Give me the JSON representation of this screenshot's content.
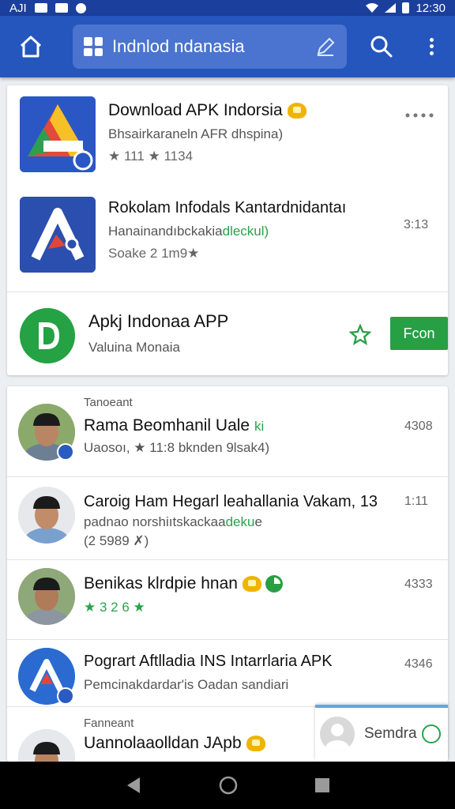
{
  "status": {
    "left_text": "AJI",
    "time": "12:30"
  },
  "appbar": {
    "search_text": "Indnlod ndanasia"
  },
  "apps": [
    {
      "title": "Download APK Indorsia",
      "subtitle": "Bhsairkaraneln AFR dhspina)",
      "rating": "★ 111 ★ 1134"
    },
    {
      "title": "Rokolam Infodals Kantardnidantaı",
      "subtitle_a": "Hanainandıbckakia",
      "subtitle_b": "dleckul)",
      "meta": "Soake 2 1m9★",
      "time": "3:13"
    },
    {
      "title": "Apkj Indonaa APP",
      "subtitle": "Valuina Monaia",
      "button": "Fcon"
    }
  ],
  "feed_label_1": "Tanoeant",
  "feed": [
    {
      "title": "Rama Beomhanil Uale",
      "title_tag": "ki",
      "meta": "Uaosoı, ★ 11:8 bknden 9lsak4)",
      "time": "4308"
    },
    {
      "title": "Caroig Ham Hegarl leahallania Vakam, 13",
      "line2_a": "padnao norshiıtskackaa",
      "line2_b": "deku",
      "line2_c": "e",
      "meta": "(2 5989 ✗)",
      "time": "1:11"
    },
    {
      "title": "Benikas klrdpie hnan",
      "rating": "★ 3 2 6 ★",
      "time": "4333"
    },
    {
      "title": "Pogrart Aftlladia INS Intarrlaria APK",
      "subtitle": "Pemcinakdardar'is Oadan sandiari",
      "time": "4346"
    }
  ],
  "feed_label_2": "Fanneant",
  "last_item": {
    "title": "Uannolaaolldan JApb"
  },
  "snack": {
    "label": "Semdra"
  },
  "colors": {
    "appbar": "#2456bd",
    "status": "#1b3f9c",
    "green": "#27a045"
  }
}
